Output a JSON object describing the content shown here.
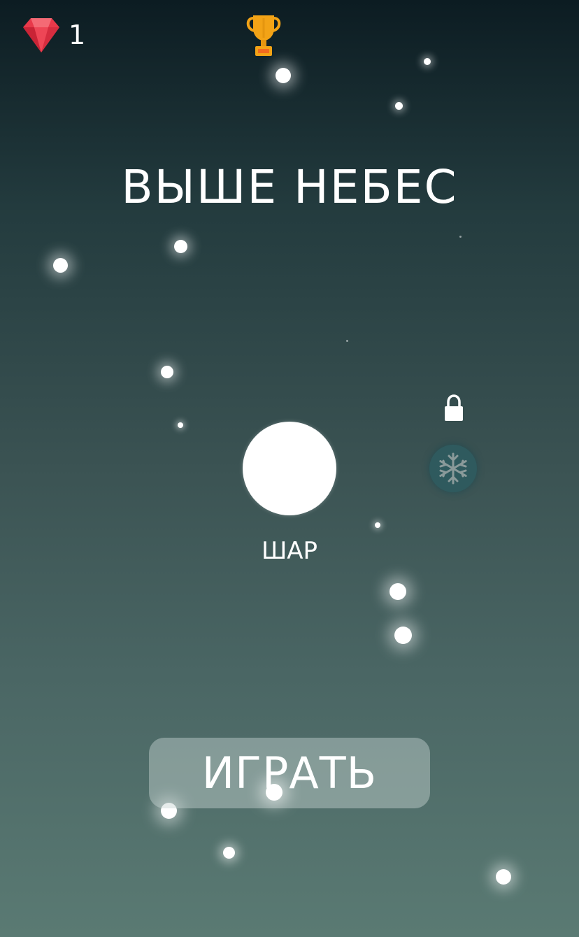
{
  "hud": {
    "gem_count": "1",
    "gem_icon": "red-gem-icon",
    "trophy_icon": "trophy-icon"
  },
  "title": "ВЫШЕ НЕБЕС",
  "selected_skin": {
    "label": "ШАР",
    "color": "#ffffff"
  },
  "locked_skin": {
    "icon": "snowflake-icon",
    "lock_icon": "lock-icon",
    "color": "#2f5a5e"
  },
  "play_button": {
    "label": "ИГРАТЬ"
  },
  "colors": {
    "background_top": "#0c1c22",
    "background_bottom": "#5a7a73",
    "gem": "#e8394a",
    "trophy": "#f3a316",
    "text": "#ffffff"
  }
}
